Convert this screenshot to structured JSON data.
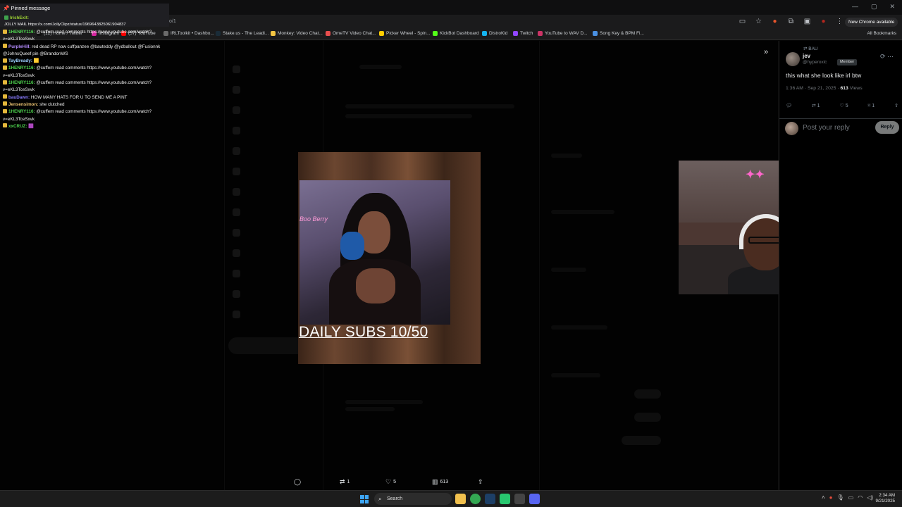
{
  "browser": {
    "url_fragment": "o/1",
    "new_chrome_label": "New Chrome available",
    "all_bookmarks": "All Bookmarks",
    "window_controls": [
      "—",
      "▢",
      "✕"
    ],
    "bookmarks": [
      {
        "label": "(12) Home / Twitter",
        "color": "#111111"
      },
      {
        "label": "Instagram",
        "color": "#d6249f"
      },
      {
        "label": "(57) YouTube",
        "color": "#ff0000"
      },
      {
        "label": "IRLToolkit • Dashbo...",
        "color": "#6b6b6b"
      },
      {
        "label": "Stake.us - The Leadi...",
        "color": "#1a2c38"
      },
      {
        "label": "Monkey: Video Chat...",
        "color": "#f4c542"
      },
      {
        "label": "OmeTV Video Chat...",
        "color": "#e94e4e"
      },
      {
        "label": "Picker Wheel - Spin...",
        "color": "#ffcc00"
      },
      {
        "label": "KickBot Dashboard",
        "color": "#53fc18"
      },
      {
        "label": "DistroKid",
        "color": "#14b3ee"
      },
      {
        "label": "Twitch",
        "color": "#9146ff"
      },
      {
        "label": "YouTube to WAV D...",
        "color": "#cc3366"
      },
      {
        "label": "Song Key & BPM Fi...",
        "color": "#4a90e2"
      }
    ]
  },
  "chat": {
    "pinned_title": "Pinned message",
    "pinned_user": "IrishExit:",
    "pinned_text": "JOLLY MAIL https://x.com/JollyClipz/status/1969643825061904837",
    "lines": [
      {
        "user": "1HENRY116:",
        "color": "#4fd44f",
        "text": " @cuffem read comments https://www.youtube.com/watch?"
      },
      {
        "user": "",
        "color": "#ffffff",
        "text": "v=eKL3TceSxvk"
      },
      {
        "user": "PurpleHill:",
        "color": "#b58cff",
        "text": " red dead RP now cuffpanzee @bauteddy @ydballout @Fusionnk"
      },
      {
        "user": "",
        "color": "#ffffff",
        "text": "@JohnsQueef pin @BrandonWS"
      },
      {
        "user": "TayBready:",
        "color": "#9ad0ff",
        "text": " 🟨"
      },
      {
        "user": "1HENRY116:",
        "color": "#4fd44f",
        "text": " @cuffem read comments https://www.youtube.com/watch?"
      },
      {
        "user": "",
        "color": "#ffffff",
        "text": "v=eKL3TceSxvk"
      },
      {
        "user": "1HENRY116:",
        "color": "#4fd44f",
        "text": " @cuffem read comments https://www.youtube.com/watch?"
      },
      {
        "user": "",
        "color": "#ffffff",
        "text": "v=eKL3TceSxvk"
      },
      {
        "user": "bauDawn:",
        "color": "#8a7cff",
        "text": " HOW MANY HATS FOR U TO SEND ME A PINT"
      },
      {
        "user": "Jensensimon:",
        "color": "#e8c070",
        "text": " she clutched"
      },
      {
        "user": "1HENRY116:",
        "color": "#4fd44f",
        "text": " @cuffem read comments https://www.youtube.com/watch?"
      },
      {
        "user": "",
        "color": "#ffffff",
        "text": "v=eKL3TceSxvk"
      },
      {
        "user": "xxCRUZ:",
        "color": "#4fd44f",
        "text": " 🟪"
      }
    ]
  },
  "tweet": {
    "retweeter": "BAU",
    "name": "jev",
    "handle": "@hyperoxlc",
    "member_badge": "Member",
    "text": "this what she look like irl btw",
    "time": "1:36 AM · Sep 21, 2025 · ",
    "views_count": "613",
    "views_label": " Views",
    "retweets": "1",
    "likes": "5",
    "bookmarks": "1",
    "reply_placeholder": "Post your reply",
    "reply_button": "Reply"
  },
  "media": {
    "caption": "DAILY SUBS 10/50",
    "neon_sign": "Boo Berry"
  },
  "video_bar": {
    "retweets": "1",
    "likes": "5",
    "views": "613"
  },
  "taskbar": {
    "search_label": "Search",
    "time": "2:34 AM",
    "date": "9/21/2025"
  }
}
